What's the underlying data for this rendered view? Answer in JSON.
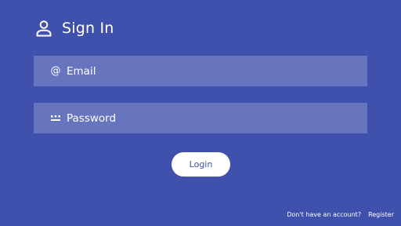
{
  "header": {
    "title": "Sign In",
    "icon": "user-icon"
  },
  "form": {
    "email": {
      "icon": "at-icon",
      "placeholder": "Email",
      "value": ""
    },
    "password": {
      "icon": "password-dots-icon",
      "placeholder": "Password",
      "value": ""
    },
    "login_label": "Login"
  },
  "footer": {
    "prompt": "Don't have an account?",
    "register_label": "Register"
  },
  "colors": {
    "background": "#3f51ac",
    "field_background": "#6675bd",
    "text": "#ffffff",
    "button_background": "#ffffff",
    "button_text": "#3f51ac"
  }
}
